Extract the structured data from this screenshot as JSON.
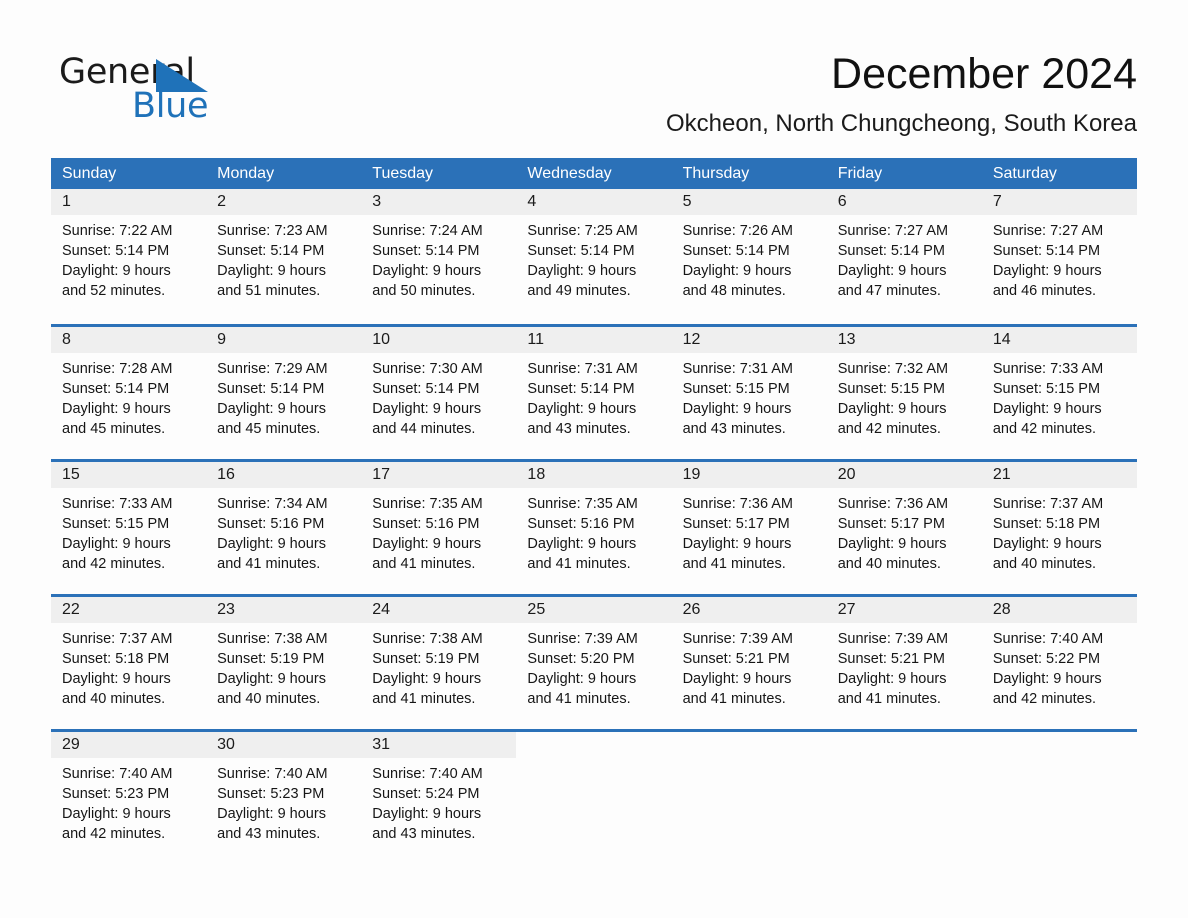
{
  "brand": {
    "name_part1": "General",
    "name_part2": "Blue",
    "triangle_color": "#1f72b9"
  },
  "header": {
    "title": "December 2024",
    "location": "Okcheon, North Chungcheong, South Korea"
  },
  "theme": {
    "header_blue": "#2b71b8",
    "daynum_bg": "#efefef",
    "page_bg": "#fdfdfd",
    "text": "#1b1b1b"
  },
  "weekday_headers": [
    "Sunday",
    "Monday",
    "Tuesday",
    "Wednesday",
    "Thursday",
    "Friday",
    "Saturday"
  ],
  "weeks": [
    [
      {
        "day": "1",
        "sunrise": "Sunrise: 7:22 AM",
        "sunset": "Sunset: 5:14 PM",
        "daylight1": "Daylight: 9 hours",
        "daylight2": "and 52 minutes."
      },
      {
        "day": "2",
        "sunrise": "Sunrise: 7:23 AM",
        "sunset": "Sunset: 5:14 PM",
        "daylight1": "Daylight: 9 hours",
        "daylight2": "and 51 minutes."
      },
      {
        "day": "3",
        "sunrise": "Sunrise: 7:24 AM",
        "sunset": "Sunset: 5:14 PM",
        "daylight1": "Daylight: 9 hours",
        "daylight2": "and 50 minutes."
      },
      {
        "day": "4",
        "sunrise": "Sunrise: 7:25 AM",
        "sunset": "Sunset: 5:14 PM",
        "daylight1": "Daylight: 9 hours",
        "daylight2": "and 49 minutes."
      },
      {
        "day": "5",
        "sunrise": "Sunrise: 7:26 AM",
        "sunset": "Sunset: 5:14 PM",
        "daylight1": "Daylight: 9 hours",
        "daylight2": "and 48 minutes."
      },
      {
        "day": "6",
        "sunrise": "Sunrise: 7:27 AM",
        "sunset": "Sunset: 5:14 PM",
        "daylight1": "Daylight: 9 hours",
        "daylight2": "and 47 minutes."
      },
      {
        "day": "7",
        "sunrise": "Sunrise: 7:27 AM",
        "sunset": "Sunset: 5:14 PM",
        "daylight1": "Daylight: 9 hours",
        "daylight2": "and 46 minutes."
      }
    ],
    [
      {
        "day": "8",
        "sunrise": "Sunrise: 7:28 AM",
        "sunset": "Sunset: 5:14 PM",
        "daylight1": "Daylight: 9 hours",
        "daylight2": "and 45 minutes."
      },
      {
        "day": "9",
        "sunrise": "Sunrise: 7:29 AM",
        "sunset": "Sunset: 5:14 PM",
        "daylight1": "Daylight: 9 hours",
        "daylight2": "and 45 minutes."
      },
      {
        "day": "10",
        "sunrise": "Sunrise: 7:30 AM",
        "sunset": "Sunset: 5:14 PM",
        "daylight1": "Daylight: 9 hours",
        "daylight2": "and 44 minutes."
      },
      {
        "day": "11",
        "sunrise": "Sunrise: 7:31 AM",
        "sunset": "Sunset: 5:14 PM",
        "daylight1": "Daylight: 9 hours",
        "daylight2": "and 43 minutes."
      },
      {
        "day": "12",
        "sunrise": "Sunrise: 7:31 AM",
        "sunset": "Sunset: 5:15 PM",
        "daylight1": "Daylight: 9 hours",
        "daylight2": "and 43 minutes."
      },
      {
        "day": "13",
        "sunrise": "Sunrise: 7:32 AM",
        "sunset": "Sunset: 5:15 PM",
        "daylight1": "Daylight: 9 hours",
        "daylight2": "and 42 minutes."
      },
      {
        "day": "14",
        "sunrise": "Sunrise: 7:33 AM",
        "sunset": "Sunset: 5:15 PM",
        "daylight1": "Daylight: 9 hours",
        "daylight2": "and 42 minutes."
      }
    ],
    [
      {
        "day": "15",
        "sunrise": "Sunrise: 7:33 AM",
        "sunset": "Sunset: 5:15 PM",
        "daylight1": "Daylight: 9 hours",
        "daylight2": "and 42 minutes."
      },
      {
        "day": "16",
        "sunrise": "Sunrise: 7:34 AM",
        "sunset": "Sunset: 5:16 PM",
        "daylight1": "Daylight: 9 hours",
        "daylight2": "and 41 minutes."
      },
      {
        "day": "17",
        "sunrise": "Sunrise: 7:35 AM",
        "sunset": "Sunset: 5:16 PM",
        "daylight1": "Daylight: 9 hours",
        "daylight2": "and 41 minutes."
      },
      {
        "day": "18",
        "sunrise": "Sunrise: 7:35 AM",
        "sunset": "Sunset: 5:16 PM",
        "daylight1": "Daylight: 9 hours",
        "daylight2": "and 41 minutes."
      },
      {
        "day": "19",
        "sunrise": "Sunrise: 7:36 AM",
        "sunset": "Sunset: 5:17 PM",
        "daylight1": "Daylight: 9 hours",
        "daylight2": "and 41 minutes."
      },
      {
        "day": "20",
        "sunrise": "Sunrise: 7:36 AM",
        "sunset": "Sunset: 5:17 PM",
        "daylight1": "Daylight: 9 hours",
        "daylight2": "and 40 minutes."
      },
      {
        "day": "21",
        "sunrise": "Sunrise: 7:37 AM",
        "sunset": "Sunset: 5:18 PM",
        "daylight1": "Daylight: 9 hours",
        "daylight2": "and 40 minutes."
      }
    ],
    [
      {
        "day": "22",
        "sunrise": "Sunrise: 7:37 AM",
        "sunset": "Sunset: 5:18 PM",
        "daylight1": "Daylight: 9 hours",
        "daylight2": "and 40 minutes."
      },
      {
        "day": "23",
        "sunrise": "Sunrise: 7:38 AM",
        "sunset": "Sunset: 5:19 PM",
        "daylight1": "Daylight: 9 hours",
        "daylight2": "and 40 minutes."
      },
      {
        "day": "24",
        "sunrise": "Sunrise: 7:38 AM",
        "sunset": "Sunset: 5:19 PM",
        "daylight1": "Daylight: 9 hours",
        "daylight2": "and 41 minutes."
      },
      {
        "day": "25",
        "sunrise": "Sunrise: 7:39 AM",
        "sunset": "Sunset: 5:20 PM",
        "daylight1": "Daylight: 9 hours",
        "daylight2": "and 41 minutes."
      },
      {
        "day": "26",
        "sunrise": "Sunrise: 7:39 AM",
        "sunset": "Sunset: 5:21 PM",
        "daylight1": "Daylight: 9 hours",
        "daylight2": "and 41 minutes."
      },
      {
        "day": "27",
        "sunrise": "Sunrise: 7:39 AM",
        "sunset": "Sunset: 5:21 PM",
        "daylight1": "Daylight: 9 hours",
        "daylight2": "and 41 minutes."
      },
      {
        "day": "28",
        "sunrise": "Sunrise: 7:40 AM",
        "sunset": "Sunset: 5:22 PM",
        "daylight1": "Daylight: 9 hours",
        "daylight2": "and 42 minutes."
      }
    ],
    [
      {
        "day": "29",
        "sunrise": "Sunrise: 7:40 AM",
        "sunset": "Sunset: 5:23 PM",
        "daylight1": "Daylight: 9 hours",
        "daylight2": "and 42 minutes."
      },
      {
        "day": "30",
        "sunrise": "Sunrise: 7:40 AM",
        "sunset": "Sunset: 5:23 PM",
        "daylight1": "Daylight: 9 hours",
        "daylight2": "and 43 minutes."
      },
      {
        "day": "31",
        "sunrise": "Sunrise: 7:40 AM",
        "sunset": "Sunset: 5:24 PM",
        "daylight1": "Daylight: 9 hours",
        "daylight2": "and 43 minutes."
      },
      {
        "day": "",
        "sunrise": "",
        "sunset": "",
        "daylight1": "",
        "daylight2": ""
      },
      {
        "day": "",
        "sunrise": "",
        "sunset": "",
        "daylight1": "",
        "daylight2": ""
      },
      {
        "day": "",
        "sunrise": "",
        "sunset": "",
        "daylight1": "",
        "daylight2": ""
      },
      {
        "day": "",
        "sunrise": "",
        "sunset": "",
        "daylight1": "",
        "daylight2": ""
      }
    ]
  ]
}
